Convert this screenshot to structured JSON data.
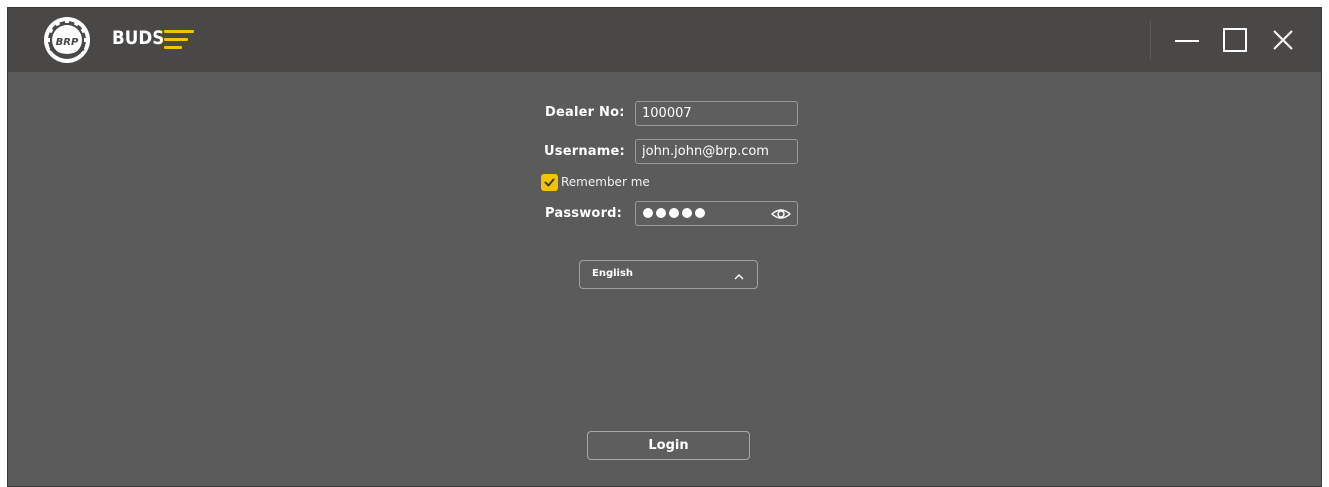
{
  "titlebar": {
    "app_name": "BUDS",
    "logo_text": "BRP",
    "icons": [
      "brp-logo",
      "menu-icon",
      "minimize-icon",
      "maximize-icon",
      "close-icon"
    ]
  },
  "form": {
    "dealer_label": "Dealer No:",
    "dealer_value": "100007",
    "username_label": "Username:",
    "username_value": "john.john@brp.com",
    "remember_label": "Remember me",
    "remember_checked": true,
    "password_label": "Password:",
    "password_length": 5,
    "password_icon": "eye-icon"
  },
  "language": {
    "selected": "English",
    "icon": "chevron-up-icon"
  },
  "login_button": "Login",
  "colors": {
    "accent": "#f5c400",
    "titlebar": "#4a4747",
    "background": "#5b5b5b"
  }
}
